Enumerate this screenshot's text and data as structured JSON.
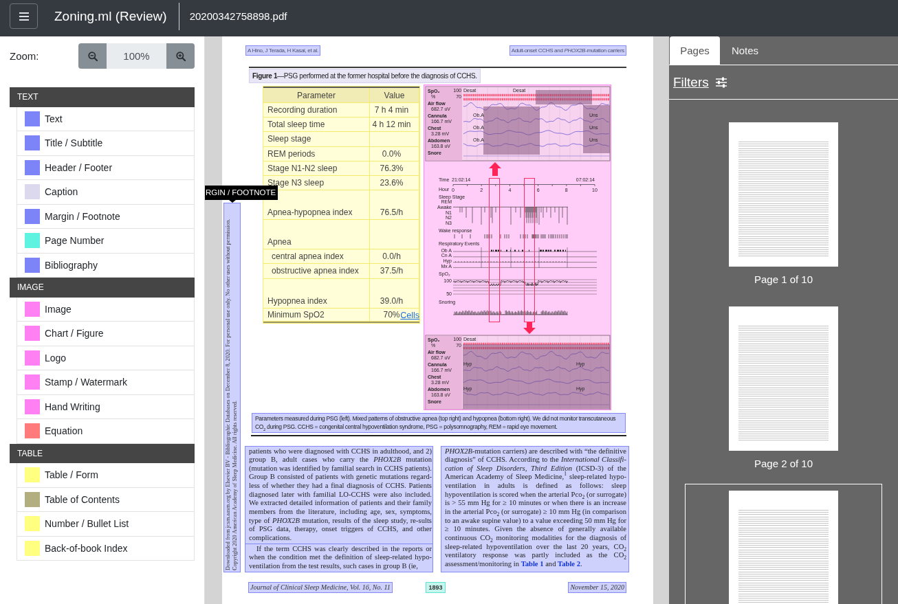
{
  "app_bar": {
    "title": "Zoning.ml (Review)",
    "file_name": "20200342758898.pdf"
  },
  "zoom": {
    "label": "Zoom:",
    "value": "100%"
  },
  "categories": [
    {
      "heading": "TEXT",
      "items": [
        {
          "label": "Text",
          "color": "#7d84f7"
        },
        {
          "label": "Title / Subtitle",
          "color": "#7d84f7"
        },
        {
          "label": "Header / Footer",
          "color": "#7d84f7"
        },
        {
          "label": "Caption",
          "color": "#dcd9ee"
        },
        {
          "label": "Margin / Footnote",
          "color": "#7d84f7"
        },
        {
          "label": "Page Number",
          "color": "#5ef2e0"
        },
        {
          "label": "Bibliography",
          "color": "#7d84f7"
        }
      ]
    },
    {
      "heading": "IMAGE",
      "items": [
        {
          "label": "Image",
          "color": "#ff80f3"
        },
        {
          "label": "Chart / Figure",
          "color": "#ff80f3"
        },
        {
          "label": "Logo",
          "color": "#ff80f3"
        },
        {
          "label": "Stamp / Watermark",
          "color": "#ff80f3"
        },
        {
          "label": "Hand Writing",
          "color": "#ff80f3"
        },
        {
          "label": "Equation",
          "color": "#ff7a7a"
        }
      ]
    },
    {
      "heading": "TABLE",
      "items": [
        {
          "label": "Table / Form",
          "color": "#ffff80"
        },
        {
          "label": "Table of Contents",
          "color": "#b3ae80"
        },
        {
          "label": "Number / Bullet List",
          "color": "#ffff80"
        },
        {
          "label": "Back-of-book Index",
          "color": "#ffff80"
        }
      ]
    }
  ],
  "document": {
    "margin_label": "RGIN / FOOTNOTE",
    "margin_note": "Downloaded from jcsm.aasm.org by Elsevier BV - Bibliographic Databases on December 8, 2020. For personal use only. No other uses without permission. Copyright 2020 American Academy of Sleep Medicine. All rights reserved.",
    "running_head": {
      "authors": "A Hino, J Terada, H Kasai, et al.",
      "title": "Adult-onset CCHS and *PHOX2B*-mutation carriers"
    },
    "figure_title": "**Figure 1**—PSG performed at the former hospital before the diagnosis of CCHS.",
    "table": {
      "columns": [
        "Parameter",
        "Value"
      ],
      "rows": [
        {
          "kind": "plain",
          "cells": [
            "Recording duration",
            "7 h 4 min"
          ]
        },
        {
          "kind": "plain",
          "cells": [
            "Total sleep time",
            "4 h 12 min"
          ]
        },
        {
          "kind": "plain",
          "cells": [
            "Sleep stage"
          ]
        },
        {
          "kind": "plain",
          "cells": [
            "REM periods",
            "0.0%"
          ]
        },
        {
          "kind": "plain",
          "cells": [
            "Stage N1-N2 sleep",
            "76.3%"
          ]
        },
        {
          "kind": "plain",
          "cells": [
            "Stage N3 sleep",
            "23.6%"
          ]
        },
        {
          "kind": "spaced",
          "cells": [
            "Apnea-hypopnea index",
            "76.5/h"
          ]
        },
        {
          "kind": "spaced",
          "cells": [
            "Apnea"
          ],
          "children": [
            {
              "kind": "plain",
              "cells": [
                "central apnea index",
                "0.0/h"
              ]
            },
            {
              "kind": "plain",
              "cells": [
                "obstructive apnea index",
                "37.5/h"
              ]
            }
          ]
        },
        {
          "kind": "spaced",
          "cells": [
            "Hypopnea index",
            "39.0/h"
          ]
        },
        {
          "kind": "plain",
          "cells": [
            "Minimum SpO2",
            "70%"
          ]
        }
      ],
      "region_link": "Cells"
    },
    "figure": {
      "top_panel": {
        "scale": [
          "100",
          "70"
        ],
        "channels": [
          {
            "name": "SpO₂",
            "unit": "%",
            "events": [
              "Desat",
              "Desat"
            ]
          },
          {
            "name": "Air flow",
            "unit": "682.7 uV"
          },
          {
            "name": "Cannula",
            "unit": "166.7 mV",
            "events": [
              "Ob.A",
              "Uns"
            ]
          },
          {
            "name": "Chest",
            "unit": "3.28 mV",
            "events": [
              "Ob.A",
              "Uns"
            ]
          },
          {
            "name": "Abdomen",
            "unit": "163.8 uV",
            "events": [
              "Ob.A",
              "Uns"
            ]
          },
          {
            "name": "Snore"
          }
        ]
      },
      "overview": {
        "time": {
          "label": "Time",
          "start": "21:02:14",
          "end": "07:02:14",
          "unit": "Hour",
          "ticks": [
            "0",
            "2",
            "4",
            "6",
            "8",
            "10"
          ]
        },
        "sleep_stage": {
          "label": "Sleep Stage",
          "levels": [
            "REM",
            "Awake",
            "N1",
            "N2",
            "N3"
          ]
        },
        "wake_response": {
          "label": "Wake response"
        },
        "respiratory_events": {
          "label": "Respiratory Events",
          "rows": [
            "Ob A",
            "Cn A",
            "Hyp",
            "Mx A"
          ]
        },
        "spo2": {
          "label": "SpO₂",
          "scale": [
            "100",
            "50"
          ]
        },
        "snoring": {
          "label": "Snoring"
        }
      },
      "bottom_panel": {
        "scale": [
          "100",
          "70"
        ],
        "channels": [
          {
            "name": "SpO₂",
            "unit": "%",
            "events": [
              "Desat"
            ]
          },
          {
            "name": "Air flow",
            "unit": "682.7 uV"
          },
          {
            "name": "Cannula",
            "unit": "166.7 mV",
            "events": [
              "Hyp",
              "Hyp"
            ]
          },
          {
            "name": "Chest",
            "unit": "3.28 mV"
          },
          {
            "name": "Abdomen",
            "unit": "163.8 uV",
            "events": [
              "Hyp",
              "Hyp"
            ]
          },
          {
            "name": "Snore"
          }
        ]
      }
    },
    "caption": "Parameters measured during PSG (left). Mixed patterns of obstructive apnea (top right) and hypopnea (bottom right). We did not monitor transcutaneous CO$_{2}$ during PSG. CCHS = congenital central hypoventilation syndrome, PSG = polysomnography, REM = rapid eye movement.",
    "columns": [
      {
        "paragraphs": [
          {
            "kind": "continuation",
            "segments": [
              {
                "kind": "text",
                "text": "patients who were diagnosed with CCHS in adulthood, and 2) group B, adult cases who carry the *PHOX2B* mutation (mutation was identified by familial search in CCHS patients). Group B consisted of patients with genetic mutations regard-less of whether they had a final diagnosis of CCHS. Patients diagnosed later with familial LO-CCHS were also included. We extracted detailed information of patients and their family members from the literature, including age, sex, symptoms, type of *PHOX2B* mutation, results of the sleep study, re-sults of PSG data, therapy, onset triggers of CCHS, and other complications."
              }
            ]
          },
          {
            "kind": "paragraph",
            "segments": [
              {
                "kind": "text",
                "text": "If the term CCHS was clearly described in the reports or when the condition met the definition of sleep-related hypo-ventilation from the test results, such cases in group B (ie,"
              }
            ]
          }
        ]
      },
      {
        "paragraphs": [
          {
            "kind": "continuation",
            "segments": [
              {
                "kind": "text",
                "text": "*PHOX2B*-mutation carriers) are described with “the definitive diagnosis” of CCHS. According to the *International Classifi-cation of Sleep Disorders, Third Edition* (ICSD-3) of the American Academy of Sleep Medicine,$^{1}$ sleep-related hypo-ventilation in adults is defined as follows: sleep hypoventilation is scored when the arterial Pco$_{2}$ (or surrogate) is > 55 mm Hg for ≥ 10 minutes or when there is an increase in the arterial Pco$_{2}$ (or surrogate) ≥ 10 mm Hg (in comparison to an awake supine value) to a value exceeding 50 mm Hg for ≥ 10 minutes. Given the absence of generally available continuous CO$_{2}$ monitoring modalities for the diagnosis of sleep-related hypoventilation over the last 20 years, CO$_{2}$ ventilatory response was partly included as the CO$_{2}$ assessment/monitoring in "
              },
              {
                "kind": "link",
                "text": "Table 1"
              },
              {
                "kind": "text",
                "text": " and "
              },
              {
                "kind": "link",
                "text": "Table 2"
              },
              {
                "kind": "text",
                "text": "."
              }
            ]
          }
        ]
      }
    ],
    "footer": {
      "journal": "Journal of Clinical Sleep Medicine, Vol. 16, No. 11",
      "page_number": "1893",
      "date": "November 15, 2020"
    }
  },
  "side_panel": {
    "tabs": [
      {
        "label": "Pages",
        "selected": true
      },
      {
        "label": "Notes",
        "selected": false
      }
    ],
    "filters": "Filters",
    "pages": [
      {
        "label": "Page 1 of 10",
        "selected": false
      },
      {
        "label": "Page 2 of 10",
        "selected": false
      },
      {
        "selected": true
      }
    ]
  }
}
